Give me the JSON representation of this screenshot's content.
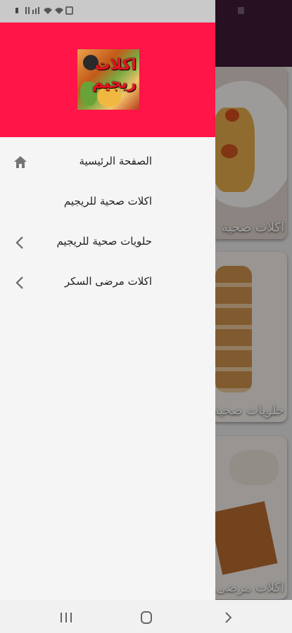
{
  "drawer": {
    "menu": [
      {
        "label": "الصفحة الرئيسية",
        "icon": "home-icon"
      },
      {
        "label": "اكلات صحية للريجيم",
        "icon": ""
      },
      {
        "label": "حلويات صحية للريجيم",
        "icon": "chevron-left-icon"
      },
      {
        "label": "اكلات مرضى السكر",
        "icon": "chevron-left-icon"
      }
    ],
    "logo_text": "اكلات ريجيم"
  },
  "background": {
    "cards": [
      {
        "title": "اكلات صحية"
      },
      {
        "title": "حلويات صحية"
      },
      {
        "title": "اكلات مرضى"
      }
    ]
  },
  "colors": {
    "drawer_header": "#ff1547",
    "toolbar": "#3c1a35"
  }
}
